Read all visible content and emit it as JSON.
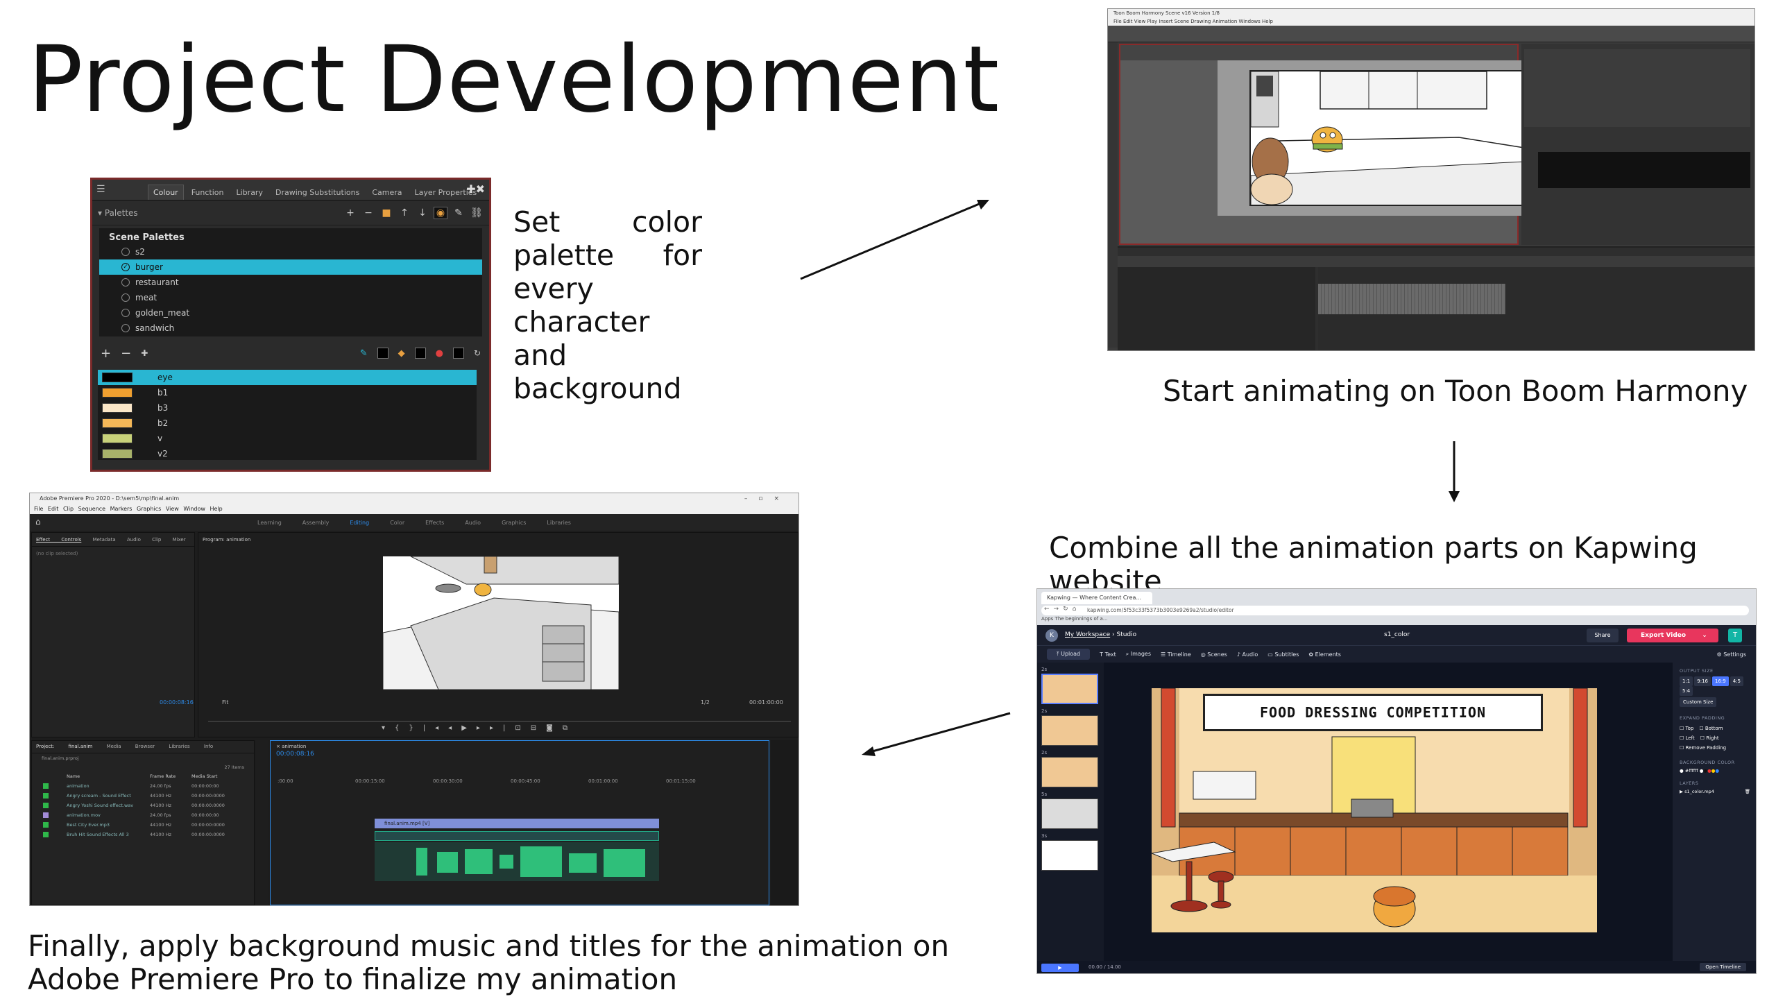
{
  "slide": {
    "title": "Project Development",
    "captions": {
      "palette_lines": [
        "Set color",
        "palette for",
        "every",
        "character",
        "and",
        "background"
      ],
      "toonboom": "Start animating on Toon Boom Harmony",
      "kapwing": "Combine all the animation parts on Kapwing website",
      "premiere_line1": "Finally, apply background music and titles for the animation on",
      "premiere_line2": "Adobe Premiere Pro to finalize my animation"
    }
  },
  "palette_panel": {
    "tabs": [
      "Colour",
      "Function",
      "Library",
      "Drawing Substitutions",
      "Camera",
      "Layer Properties"
    ],
    "palettes_label": "Palettes",
    "scene_palettes_header": "Scene Palettes",
    "scene_palettes": [
      "s2",
      "burger",
      "restaurant",
      "meat",
      "golden_meat",
      "sandwich"
    ],
    "selected_palette": "burger",
    "colors": [
      {
        "name": "eye",
        "hex": "#000000"
      },
      {
        "name": "b1",
        "hex": "#f0a030"
      },
      {
        "name": "b3",
        "hex": "#fbe7c8"
      },
      {
        "name": "b2",
        "hex": "#f5b858"
      },
      {
        "name": "v",
        "hex": "#c8d27a"
      },
      {
        "name": "v2",
        "hex": "#a8b26a"
      }
    ],
    "selected_color": "eye"
  },
  "toonboom": {
    "window_title": "Toon Boom Harmony Scene v16 Version 1/8",
    "menu": "File  Edit  View  Play  Insert  Scene  Drawing  Animation  Windows  Help"
  },
  "premiere": {
    "window_title": "Adobe Premiere Pro 2020 - D:\\sem5\\mp\\final.anim",
    "menu": "File Edit Clip Sequence Markers Graphics View Window Help",
    "workspaces": [
      "Learning",
      "Assembly",
      "Editing",
      "Color",
      "Effects",
      "Audio",
      "Graphics",
      "Libraries"
    ],
    "active_workspace": "Editing",
    "effect_tabs": [
      "Effect Controls",
      "Metadata",
      "Audio Clip Mixer"
    ],
    "no_clip": "(no clip selected)",
    "program_tab": "Program: animation",
    "program_timecode": "00:00:08:16",
    "program_fit": "Fit",
    "program_duration": "00:01:00:00",
    "program_quality": "1/2",
    "project_tabs": [
      "Project: final.anim",
      "Media Browser",
      "Libraries",
      "Info"
    ],
    "project_file": "final.anim.prproj",
    "items_count": "27 Items",
    "project_columns": [
      "Name",
      "Frame Rate",
      "Media Start"
    ],
    "project_items": [
      {
        "name": "animation",
        "fps": "24.00 fps",
        "start": "00:00:00:00",
        "color": "#2fb84a"
      },
      {
        "name": "Angry scream - Sound Effect",
        "fps": "44100 Hz",
        "start": "00:00:00:0000",
        "color": "#2fb84a"
      },
      {
        "name": "Angry Yoshi Sound effect.wav",
        "fps": "44100 Hz",
        "start": "00:00:00:0000",
        "color": "#2fb84a"
      },
      {
        "name": "animation.mov",
        "fps": "24.00 fps",
        "start": "00:00:00:00",
        "color": "#a38cd8"
      },
      {
        "name": "Best City Ever.mp3",
        "fps": "44100 Hz",
        "start": "00:00:00:0000",
        "color": "#2fb84a"
      },
      {
        "name": "Bruh Hit Sound Effects All 3",
        "fps": "44100 Hz",
        "start": "00:00:00:0000",
        "color": "#2fb84a"
      }
    ],
    "timeline_tab": "animation",
    "timeline_timecode": "00:00:08:16",
    "ruler": [
      ":00:00",
      "00:00:15:00",
      "00:00:30:00",
      "00:00:45:00",
      "00:01:00:00",
      "00:01:15:00"
    ],
    "video_clip": "final.anim.mp4 [V]"
  },
  "kapwing": {
    "tab_title": "Kapwing — Where Content Crea...",
    "url": "kapwing.com/5f53c33f5373b3003e9269a2/studio/editor",
    "bookmarks": "Apps   The beginnings of a...",
    "breadcrumb": "My Workspace",
    "breadcrumb_rest": " › Studio",
    "file_name": "s1_color",
    "share": "Share",
    "export": "Export Video",
    "avatar": "T",
    "toolbar": [
      "Upload",
      "Text",
      "Images",
      "Timeline",
      "Scenes",
      "Audio",
      "Subtitles",
      "Elements"
    ],
    "settings": "Settings",
    "scene_labels": [
      "2s",
      "2s",
      "2s",
      "5s",
      "3s"
    ],
    "sign_text": "FOOD DRESSING COMPETITION",
    "side": {
      "output_size": "Output Size",
      "ratios": [
        "1:1",
        "9:16",
        "16:9",
        "4:5",
        "5:4"
      ],
      "active_ratio": "16:9",
      "custom_size": "Custom Size",
      "expand_padding": "Expand Padding",
      "paddings": [
        "Top",
        "Bottom",
        "Left",
        "Right"
      ],
      "remove_padding": "Remove Padding",
      "background_color": "Background Color",
      "bg_value": "#ffffff",
      "layers": "Layers",
      "layer_item": "s1_color.mp4"
    },
    "time": "00.00 / 14.00",
    "open_timeline": "Open Timeline"
  }
}
